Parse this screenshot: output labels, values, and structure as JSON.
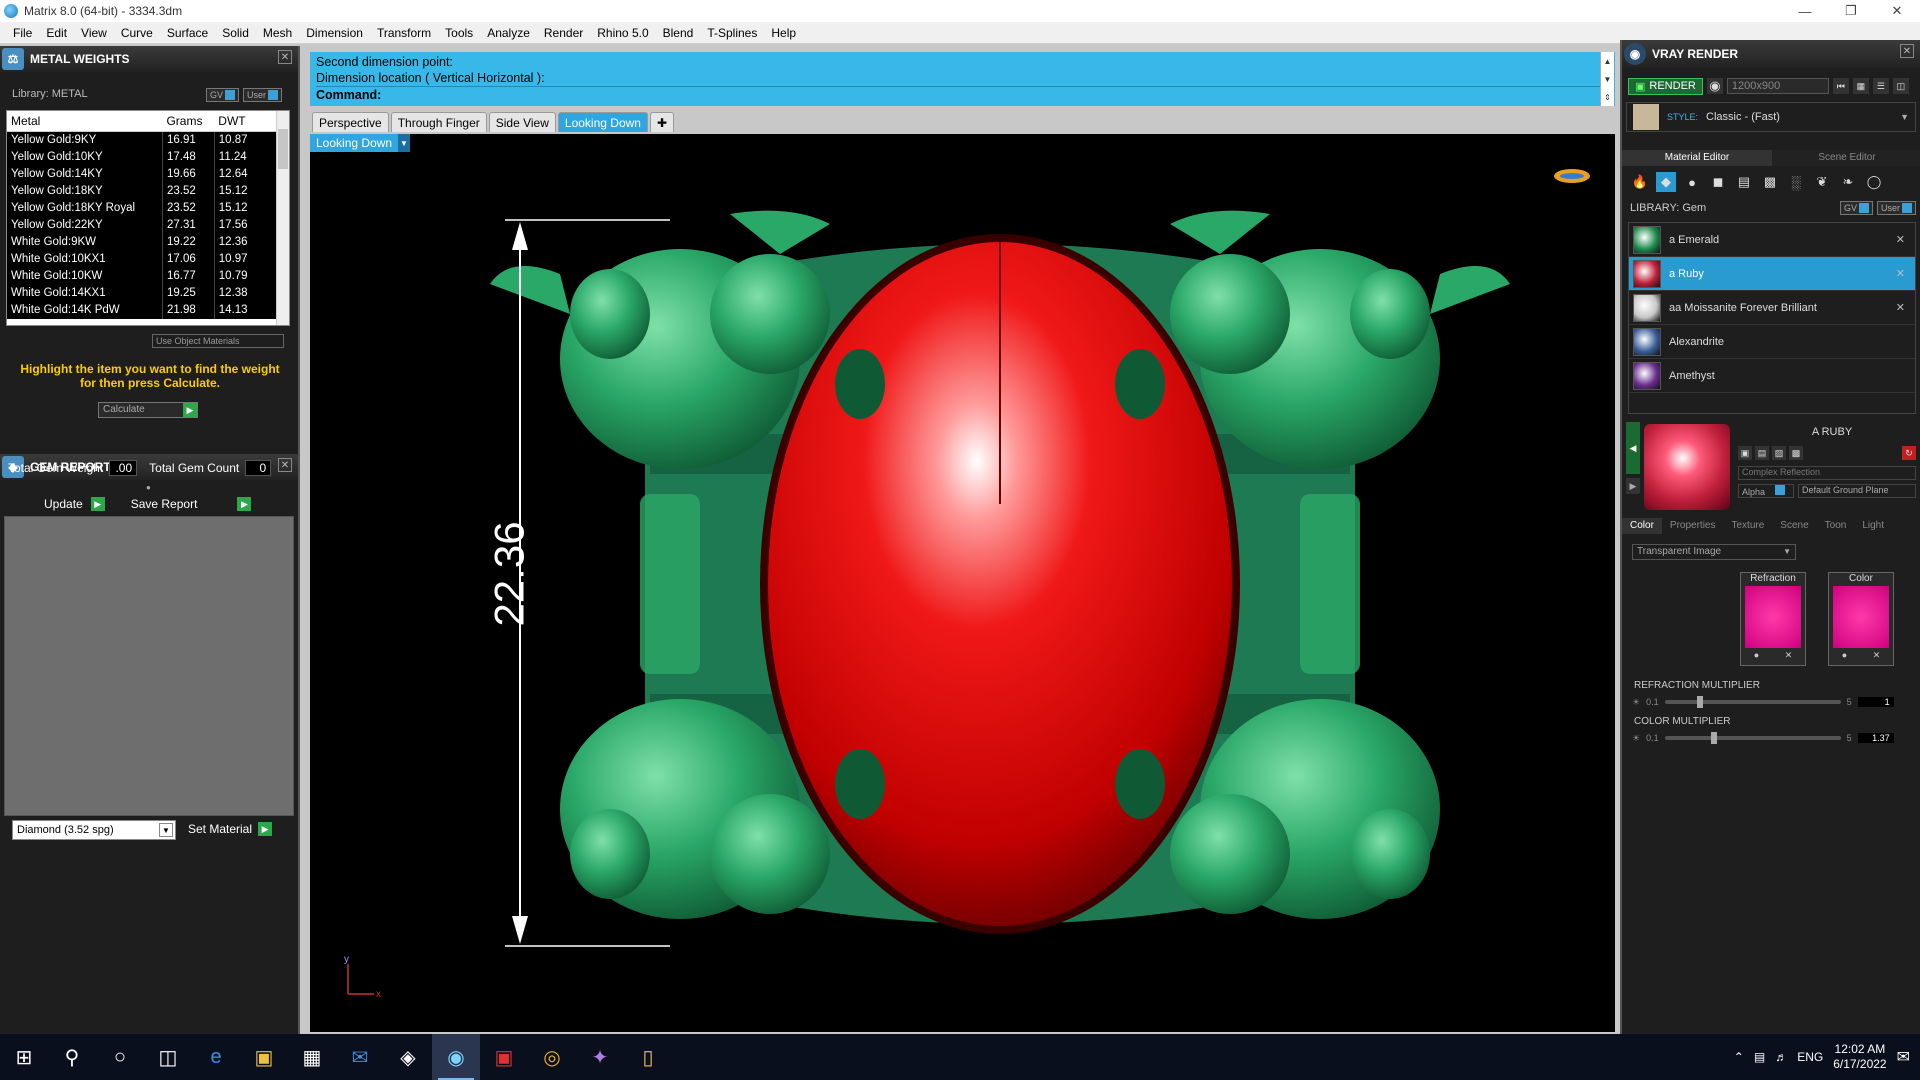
{
  "window": {
    "title": "Matrix 8.0 (64-bit) - 3334.3dm"
  },
  "menu": [
    "File",
    "Edit",
    "View",
    "Curve",
    "Surface",
    "Solid",
    "Mesh",
    "Dimension",
    "Transform",
    "Tools",
    "Analyze",
    "Render",
    "Rhino 5.0",
    "Blend",
    "T-Splines",
    "Help"
  ],
  "metal_weights": {
    "title": "METAL WEIGHTS",
    "library_label": "Library: METAL",
    "gv": "GV",
    "user": "User",
    "columns": [
      "Metal",
      "Grams",
      "DWT"
    ],
    "rows": [
      [
        "Yellow Gold:9KY",
        "16.91",
        "10.87"
      ],
      [
        "Yellow Gold:10KY",
        "17.48",
        "11.24"
      ],
      [
        "Yellow Gold:14KY",
        "19.66",
        "12.64"
      ],
      [
        "Yellow Gold:18KY",
        "23.52",
        "15.12"
      ],
      [
        "Yellow Gold:18KY Royal",
        "23.52",
        "15.12"
      ],
      [
        "Yellow Gold:22KY",
        "27.31",
        "17.56"
      ],
      [
        "White Gold:9KW",
        "19.22",
        "12.36"
      ],
      [
        "White Gold:10KX1",
        "17.06",
        "10.97"
      ],
      [
        "White Gold:10KW",
        "16.77",
        "10.79"
      ],
      [
        "White Gold:14KX1",
        "19.25",
        "12.38"
      ],
      [
        "White Gold:14K PdW",
        "21.98",
        "14.13"
      ]
    ],
    "use_object_materials": "Use Object Materials",
    "hint": "Highlight the item you want to find the weight for then press Calculate.",
    "calculate": "Calculate"
  },
  "gem_reporter": {
    "title": "GEM REPORTER",
    "total_weight_label": "Total Gem Weight",
    "total_weight_value": ".00",
    "total_count_label": "Total Gem Count",
    "total_count_value": "0",
    "update": "Update",
    "save_report": "Save Report",
    "material_select": "Diamond   (3.52 spg)",
    "set_material": "Set Material"
  },
  "command": {
    "line1": "Second dimension point:",
    "line2": "Dimension location ( Vertical  Horizontal ):",
    "prompt": "Command:"
  },
  "viewport_tabs": [
    "Perspective",
    "Through Finger",
    "Side View",
    "Looking Down"
  ],
  "active_tab": "Looking Down",
  "view_dropdown": "Looking Down",
  "dimension_value": "22.36",
  "vray": {
    "title": "VRAY RENDER",
    "render": "RENDER",
    "resolution": "1200x900",
    "style_label": "STYLE:",
    "style_value": "Classic - (Fast)",
    "tabs": [
      "Material Editor",
      "Scene Editor"
    ],
    "library_label": "LIBRARY: Gem",
    "materials": [
      {
        "name": "a Emerald",
        "color": "#1f8a4c",
        "removable": true
      },
      {
        "name": "a Ruby",
        "color": "#c0203a",
        "removable": true,
        "selected": true
      },
      {
        "name": "aa Moissanite Forever Brilliant",
        "color": "#c8c8c8",
        "removable": true
      },
      {
        "name": "Alexandrite",
        "color": "#3a5f9a",
        "removable": false
      },
      {
        "name": "Amethyst",
        "color": "#6a2d8e",
        "removable": false
      }
    ],
    "selected_name": "A RUBY",
    "reflection": "Complex Reflection",
    "alpha": "Alpha",
    "ground": "Default Ground Plane",
    "prop_tabs": [
      "Color",
      "Properties",
      "Texture",
      "Scene",
      "Toon",
      "Light"
    ],
    "transparent": "Transparent Image",
    "refraction_label": "Refraction",
    "color_label": "Color",
    "refraction_mult_label": "REFRACTION MULTIPLIER",
    "refraction_min": "0.1",
    "refraction_max": "5",
    "refraction_value": "1",
    "color_mult_label": "COLOR MULTIPLIER",
    "color_min": "0.1",
    "color_max": "5",
    "color_value": "1.37"
  },
  "taskbar": {
    "lang": "ENG",
    "time": "12:02 AM",
    "date": "6/17/2022"
  }
}
